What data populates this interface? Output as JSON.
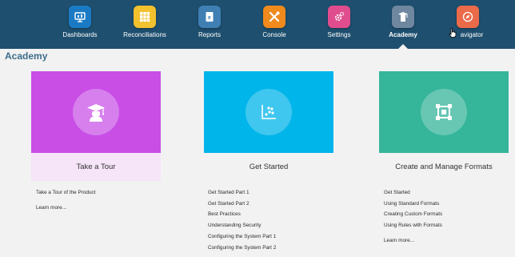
{
  "nav": {
    "items": [
      {
        "label": "Dashboards",
        "icon": "dashboard-icon",
        "color": "#1a7ac4"
      },
      {
        "label": "Reconciliations",
        "icon": "grid-icon",
        "color": "#f2c12e"
      },
      {
        "label": "Reports",
        "icon": "report-icon",
        "color": "#3f7fb4"
      },
      {
        "label": "Console",
        "icon": "tools-icon",
        "color": "#f08a1c"
      },
      {
        "label": "Settings",
        "icon": "gear-icon",
        "color": "#e04d8e"
      },
      {
        "label": "Academy",
        "icon": "academy-icon",
        "color": "#6f879f",
        "active": true
      },
      {
        "label": "avigator",
        "icon": "compass-icon",
        "color": "#ea6a4a"
      }
    ]
  },
  "page": {
    "title": "Academy"
  },
  "cards": [
    {
      "title": "Take a Tour",
      "image_color": "#c84ee6",
      "icon": "graduate-icon",
      "links": [
        "Take a Tour of the Product",
        "Learn more..."
      ]
    },
    {
      "title": "Get Started",
      "image_color": "#00b5ea",
      "icon": "scatter-chart-icon",
      "links": [
        "Get Started Part 1",
        "Get Started Part 2",
        "Best Practices",
        "Understanding Security",
        "Configuring the System Part 1",
        "Configuring the System Part 2"
      ]
    },
    {
      "title": "Create and Manage Formats",
      "image_color": "#35b59a",
      "icon": "format-frame-icon",
      "links": [
        "Get Started",
        "Using Standard Formats",
        "Creating Custom Formats",
        "Using Rules with Formats",
        "Learn more..."
      ]
    }
  ]
}
